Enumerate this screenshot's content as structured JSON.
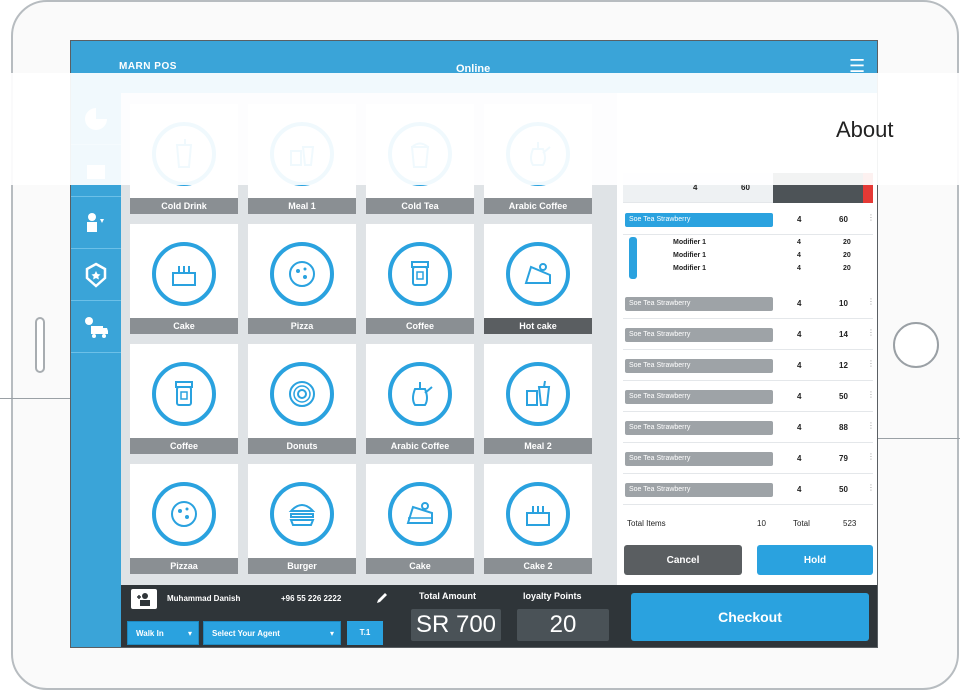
{
  "app": {
    "brand": "MARN POS",
    "status": "Online"
  },
  "nav": {
    "about": "About"
  },
  "products": [
    {
      "label": "Cold Drink",
      "icon": "cold-drink-icon"
    },
    {
      "label": "Meal 1",
      "icon": "meal-icon"
    },
    {
      "label": "Cold Tea",
      "icon": "cold-tea-icon"
    },
    {
      "label": "Arabic Coffee",
      "icon": "arabic-coffee-icon"
    },
    {
      "label": "Cake",
      "icon": "cake-icon"
    },
    {
      "label": "Pizza",
      "icon": "pizza-icon"
    },
    {
      "label": "Coffee",
      "icon": "coffee-icon"
    },
    {
      "label": "Hot cake",
      "icon": "hot-cake-icon"
    },
    {
      "label": "Coffee",
      "icon": "coffee-icon"
    },
    {
      "label": "Donuts",
      "icon": "donut-icon"
    },
    {
      "label": "Arabic Coffee",
      "icon": "arabic-coffee-icon"
    },
    {
      "label": "Meal 2",
      "icon": "meal-icon"
    },
    {
      "label": "Pizzaa",
      "icon": "pizza-icon"
    },
    {
      "label": "Burger",
      "icon": "burger-icon"
    },
    {
      "label": "Cake",
      "icon": "cake-slice-icon"
    },
    {
      "label": "Cake 2",
      "icon": "cake-icon"
    }
  ],
  "order": {
    "top_row": {
      "qty": "4",
      "price": "60"
    },
    "selected": {
      "name": "Soe Tea Strawberry",
      "qty": "4",
      "price": "60"
    },
    "modifiers": [
      {
        "name": "Modifier 1",
        "qty": "4",
        "price": "20"
      },
      {
        "name": "Modifier 1",
        "qty": "4",
        "price": "20"
      },
      {
        "name": "Modifier 1",
        "qty": "4",
        "price": "20"
      }
    ],
    "items": [
      {
        "name": "Soe Tea Strawberry",
        "qty": "4",
        "price": "10"
      },
      {
        "name": "Soe Tea Strawberry",
        "qty": "4",
        "price": "14"
      },
      {
        "name": "Soe Tea Strawberry",
        "qty": "4",
        "price": "12"
      },
      {
        "name": "Soe Tea Strawberry",
        "qty": "4",
        "price": "50"
      },
      {
        "name": "Soe Tea Strawberry",
        "qty": "4",
        "price": "88"
      },
      {
        "name": "Soe Tea Strawberry",
        "qty": "4",
        "price": "79"
      },
      {
        "name": "Soe Tea Strawberry",
        "qty": "4",
        "price": "50"
      }
    ],
    "total_items_label": "Total Items",
    "total_items": "10",
    "total_label": "Total",
    "total": "523"
  },
  "actions": {
    "cancel": "Cancel",
    "hold": "Hold",
    "checkout": "Checkout"
  },
  "customer": {
    "name": "Muhammad Danish",
    "phone": "+96 55 226 2222"
  },
  "selectors": {
    "walk_in": "Walk In",
    "agent": "Select Your Agent",
    "table": "T.1"
  },
  "amount": {
    "label": "Total Amount",
    "value": "SR 700"
  },
  "loyalty": {
    "label": "loyalty Points",
    "value": "20"
  },
  "colors": {
    "accent": "#2aa2df",
    "dark": "#2f3539",
    "tile_label": "#8a8f93"
  }
}
